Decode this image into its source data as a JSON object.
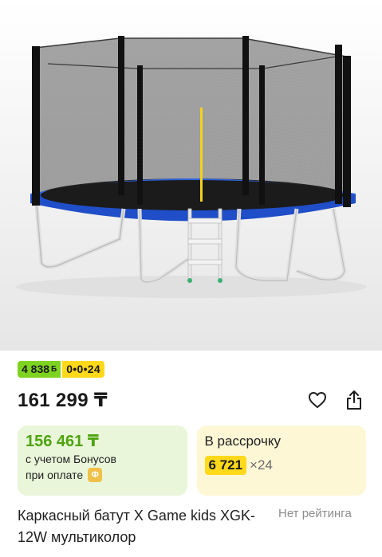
{
  "product": {
    "bonus_badge": "4 838",
    "bonus_symbol": "Б",
    "installment_badge": "0•0•24",
    "price": "161 299 ₸",
    "bonus_price": "156 461 ₸",
    "bonus_price_line1": "с учетом Бонусов",
    "bonus_price_line2": "при оплате",
    "bonus_coin": "Ф",
    "installment_title": "В рассрочку",
    "installment_amount": "6 721",
    "installment_months": "×24",
    "name": "Каркасный батут X Game kids XGK-12W мультиколор",
    "rating": "Нет рейтинга"
  },
  "icons": {
    "favorite": "heart-icon",
    "share": "share-icon"
  },
  "colors": {
    "bonus_green": "#7ed321",
    "accent_yellow": "#ffd91a",
    "bonus_card_bg": "#e9f6d9",
    "install_card_bg": "#fdf7d6",
    "bonus_price_text": "#4ea30f",
    "trampoline_blue": "#1f4ec8"
  }
}
